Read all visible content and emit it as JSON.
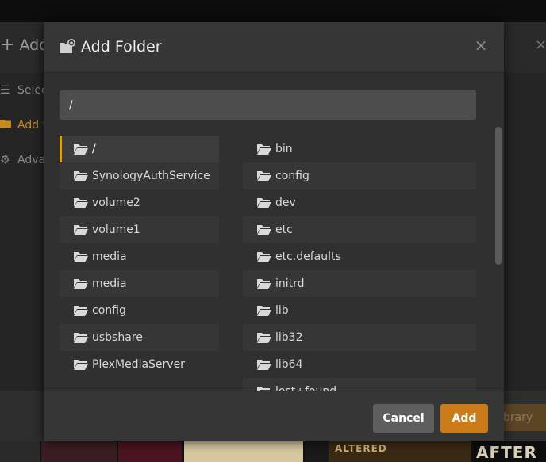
{
  "background": {
    "title": "Add",
    "nav": [
      {
        "label": "Selec",
        "icon": "list-icon",
        "active": false
      },
      {
        "label": "Add f",
        "icon": "folder-icon",
        "active": true
      },
      {
        "label": "Adva",
        "icon": "gear-icon",
        "active": false
      }
    ],
    "footer_button": "brary",
    "poster_texts": [
      "AFTER",
      "ALTERED"
    ]
  },
  "modal": {
    "title": "Add Folder",
    "title_icon": "folder-add-icon",
    "close_label": "×",
    "path_value": "/",
    "left_column": [
      {
        "label": "/",
        "selected": true
      },
      {
        "label": "SynologyAuthService"
      },
      {
        "label": "volume2"
      },
      {
        "label": "volume1"
      },
      {
        "label": "media"
      },
      {
        "label": "media"
      },
      {
        "label": "config"
      },
      {
        "label": "usbshare"
      },
      {
        "label": "PlexMediaServer"
      }
    ],
    "right_column": [
      {
        "label": "bin"
      },
      {
        "label": "config"
      },
      {
        "label": "dev"
      },
      {
        "label": "etc"
      },
      {
        "label": "etc.defaults"
      },
      {
        "label": "initrd"
      },
      {
        "label": "lib"
      },
      {
        "label": "lib32"
      },
      {
        "label": "lib64"
      },
      {
        "label": "lost+found"
      }
    ],
    "cancel_label": "Cancel",
    "add_label": "Add"
  },
  "colors": {
    "accent": "#e5a00d",
    "add_button": "#cc7b19",
    "cancel_button": "#5e5e5e"
  }
}
